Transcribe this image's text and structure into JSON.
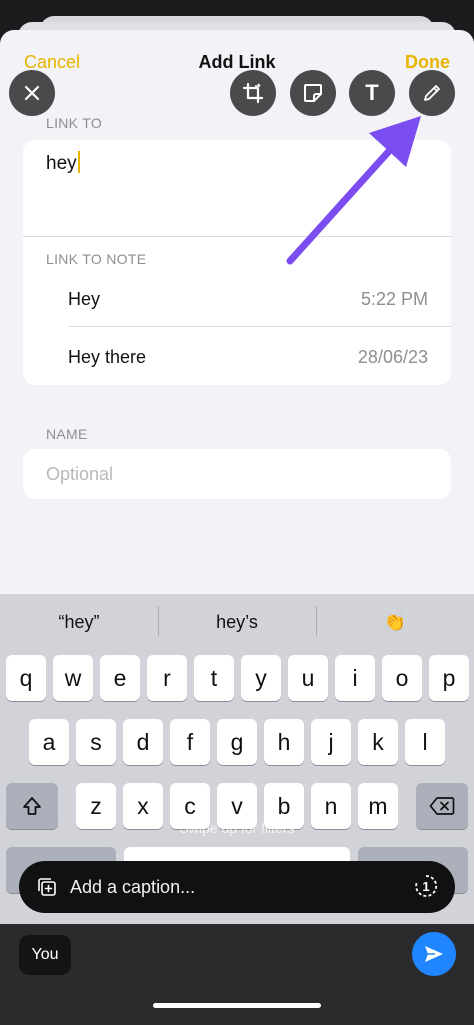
{
  "nav": {
    "cancel": "Cancel",
    "title": "Add Link",
    "done": "Done"
  },
  "tools": [
    "close-icon",
    "crop-icon",
    "sticker-icon",
    "text-icon",
    "pencil-icon"
  ],
  "tool_text": "T",
  "link_to": {
    "label": "LINK TO",
    "value": "hey"
  },
  "link_to_note": {
    "label": "LINK TO NOTE",
    "items": [
      {
        "title": "Hey",
        "meta": "5:22 PM"
      },
      {
        "title": "Hey there",
        "meta": "28/06/23"
      }
    ]
  },
  "name": {
    "label": "NAME",
    "placeholder": "Optional"
  },
  "suggestions": [
    "“hey”",
    "hey’s",
    "👏"
  ],
  "keyboard": {
    "row1": [
      "q",
      "w",
      "e",
      "r",
      "t",
      "y",
      "u",
      "i",
      "o",
      "p"
    ],
    "row2": [
      "a",
      "s",
      "d",
      "f",
      "g",
      "h",
      "j",
      "k",
      "l"
    ],
    "row3": [
      "z",
      "x",
      "c",
      "v",
      "b",
      "n",
      "m"
    ]
  },
  "swipe_hint": "Swipe up for filters",
  "caption": {
    "placeholder": "Add a caption...",
    "hd_badge": "1"
  },
  "recipient": "You",
  "colors": {
    "accent": "#e8b400",
    "arrow": "#7b4cf0",
    "send": "#1f86ff"
  }
}
